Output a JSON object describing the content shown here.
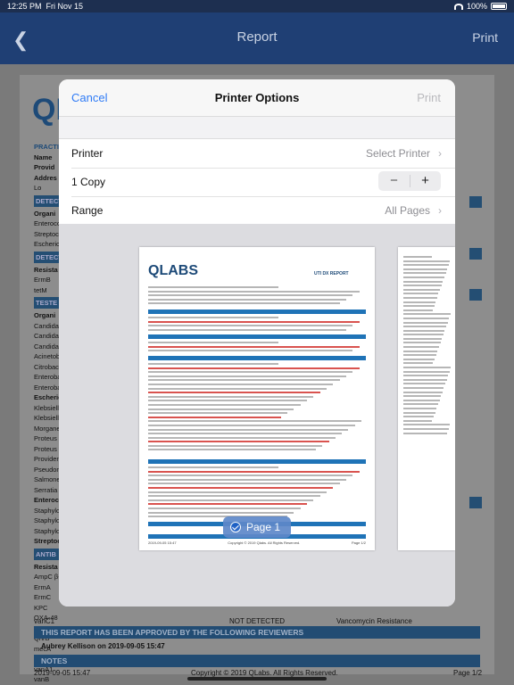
{
  "status_bar": {
    "time": "12:25 PM",
    "date": "Fri Nov 15",
    "battery": "100%"
  },
  "nav": {
    "title": "Report",
    "print": "Print"
  },
  "background_report": {
    "logo": "QLABS",
    "sidebar": [
      {
        "text": "PRACTI",
        "kind": "pi"
      },
      {
        "text": "Name",
        "kind": "b"
      },
      {
        "text": "Provid",
        "kind": "b"
      },
      {
        "text": "Addres",
        "kind": "b"
      },
      {
        "text": "Lo",
        "kind": "t"
      },
      {
        "text": "DETECT",
        "kind": "hdr"
      },
      {
        "text": "Organi",
        "kind": "b"
      },
      {
        "text": "Enteroco",
        "kind": "t"
      },
      {
        "text": "Streptoc",
        "kind": "t"
      },
      {
        "text": "Escherich",
        "kind": "t"
      },
      {
        "text": "DETECT",
        "kind": "hdr"
      },
      {
        "text": "Resista",
        "kind": "b"
      },
      {
        "text": "ErmB",
        "kind": "t"
      },
      {
        "text": "tetM",
        "kind": "t"
      },
      {
        "text": "TESTE",
        "kind": "hdr"
      },
      {
        "text": "Organi",
        "kind": "b"
      },
      {
        "text": "Candida a",
        "kind": "t"
      },
      {
        "text": "Candida",
        "kind": "t"
      },
      {
        "text": "Candida p",
        "kind": "t"
      },
      {
        "text": "Acinetoba",
        "kind": "t"
      },
      {
        "text": "Citrobact",
        "kind": "t"
      },
      {
        "text": "Enterobac",
        "kind": "t"
      },
      {
        "text": "Enterobac",
        "kind": "t"
      },
      {
        "text": "Escherich",
        "kind": "b"
      },
      {
        "text": "Klebsiella",
        "kind": "t"
      },
      {
        "text": "Klebsiella",
        "kind": "t"
      },
      {
        "text": "Morganel",
        "kind": "t"
      },
      {
        "text": "Proteus m",
        "kind": "t"
      },
      {
        "text": "Proteus vu",
        "kind": "t"
      },
      {
        "text": "Providen",
        "kind": "t"
      },
      {
        "text": "Pseudom",
        "kind": "t"
      },
      {
        "text": "Salmonel",
        "kind": "t"
      },
      {
        "text": "Serratia m",
        "kind": "t"
      },
      {
        "text": "Enteroco",
        "kind": "b"
      },
      {
        "text": "Staphylo",
        "kind": "t"
      },
      {
        "text": "Staphylo",
        "kind": "t"
      },
      {
        "text": "Staphyloc",
        "kind": "t"
      },
      {
        "text": "Streptoc",
        "kind": "b"
      },
      {
        "text": "ANTIB",
        "kind": "hdr"
      },
      {
        "text": "Resista",
        "kind": "b"
      },
      {
        "text": "AmpC β-l",
        "kind": "t"
      },
      {
        "text": "ErmA",
        "kind": "t"
      },
      {
        "text": "ErmC",
        "kind": "t"
      },
      {
        "text": "KPC",
        "kind": "t"
      },
      {
        "text": "OXA-48",
        "kind": "t"
      },
      {
        "text": "QnrA",
        "kind": "t"
      },
      {
        "text": "QnrB",
        "kind": "t"
      },
      {
        "text": "mecA",
        "kind": "t"
      },
      {
        "text": "tetM",
        "kind": "b"
      },
      {
        "text": "vanA1",
        "kind": "t"
      },
      {
        "text": "vanB",
        "kind": "t"
      },
      {
        "text": "vanC1",
        "kind": "t"
      }
    ],
    "row_not_detected": "NOT DETECTED",
    "row_vanco": "Vancomycin Resistance",
    "approved_bar": "THIS REPORT HAS BEEN APPROVED BY THE FOLLOWING REVIEWERS",
    "approved_by": "Aubrey Kellison on 2019-09-05 15:47",
    "notes_bar": "NOTES",
    "footer_date": "2019-09-05 15:47",
    "footer_copy": "Copyright © 2019 QLabs. All Rights Reserved.",
    "footer_page": "Page 1/2"
  },
  "modal": {
    "cancel": "Cancel",
    "title": "Printer Options",
    "print": "Print",
    "printer_label": "Printer",
    "printer_value": "Select Printer",
    "copies_label": "1 Copy",
    "minus": "−",
    "plus": "+",
    "range_label": "Range",
    "range_value": "All Pages",
    "chevron": "›",
    "preview": {
      "logo": "QLABS",
      "report_title": "UTI DX REPORT",
      "footer_left": "2019-09-05 15:47",
      "footer_center": "Copyright © 2019 Qlabs. All Rights Reserved.",
      "footer_right": "Page 1/2",
      "page_badge": "Page 1"
    }
  }
}
